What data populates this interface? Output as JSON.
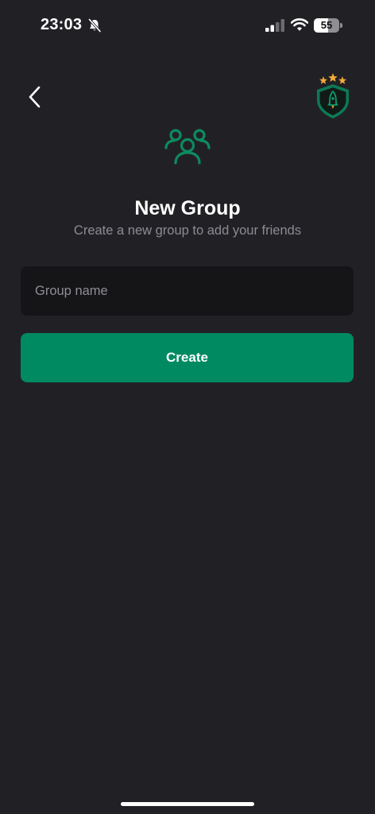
{
  "status_bar": {
    "time": "23:03",
    "battery_level": "55",
    "battery_fraction": 0.55,
    "icons": [
      "bell-slash-icon",
      "signal-icon",
      "wifi-icon",
      "battery-icon"
    ]
  },
  "nav": {
    "back_icon": "chevron-left-icon",
    "logo_icon": "rocket-shield-badge-icon"
  },
  "header": {
    "icon": "group-users-icon",
    "title": "New Group",
    "subtitle": "Create a new group to add your friends"
  },
  "form": {
    "group_name": {
      "value": "",
      "placeholder": "Group name"
    },
    "create_label": "Create"
  },
  "colors": {
    "background": "#212125",
    "input_background": "#151518",
    "accent": "#008a62",
    "icon_green": "#0e8a5f",
    "subtitle": "#8b8b93",
    "star_gold": "#f2a93b"
  }
}
